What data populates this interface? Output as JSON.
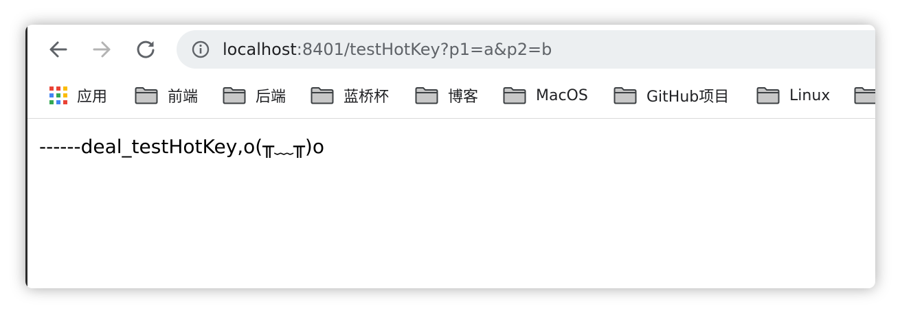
{
  "address_bar": {
    "host": "localhost",
    "rest": ":8401/testHotKey?p1=a&p2=b"
  },
  "icons": {
    "back": "arrow-left-icon",
    "forward": "arrow-right-icon",
    "reload": "reload-icon",
    "site_info": "info-icon",
    "apps": "apps-grid-icon",
    "folder": "folder-icon"
  },
  "apps_colors": [
    "#ea4335",
    "#ea4335",
    "#fbbc05",
    "#4285f4",
    "#34a853",
    "#fbbc05",
    "#34a853",
    "#4285f4",
    "#ea4335"
  ],
  "bookmarks": {
    "apps_label": "应用",
    "folders": [
      "前端",
      "后端",
      "蓝桥杯",
      "博客",
      "MacOS",
      "GitHub项目",
      "Linux"
    ]
  },
  "page": {
    "body_text": "------deal_testHotKey,o(╥﹏╥)o"
  }
}
